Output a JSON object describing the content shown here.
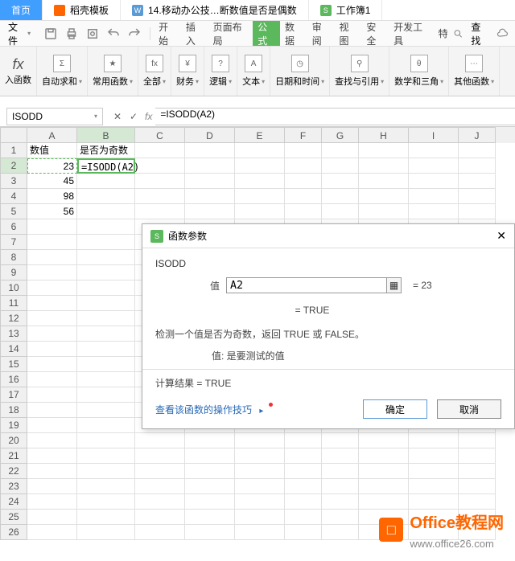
{
  "tabs": {
    "home": "首页",
    "template": "稻壳模板",
    "doc": "14.移动办公技…断数值是否是偶数",
    "workbook": "工作簿1"
  },
  "menu": {
    "file": "文件",
    "start": "开始",
    "insert": "插入",
    "layout": "页面布局",
    "formula": "公式",
    "data": "数据",
    "review": "审阅",
    "view": "视图",
    "security": "安全",
    "dev": "开发工具",
    "special": "特",
    "search": "查找"
  },
  "ribbon": {
    "insert_fn": "入函数",
    "autosum": "自动求和",
    "common": "常用函数",
    "all": "全部",
    "financial": "财务",
    "logical": "逻辑",
    "text": "文本",
    "datetime": "日期和时间",
    "lookup": "查找与引用",
    "math": "数学和三角",
    "other": "其他函数"
  },
  "formula_bar": {
    "name": "ISODD",
    "formula": "=ISODD(A2)"
  },
  "columns": [
    "A",
    "B",
    "C",
    "D",
    "E",
    "F",
    "G",
    "H",
    "I",
    "J"
  ],
  "headers": {
    "c1": "数值",
    "c2": "是否为奇数"
  },
  "rows": [
    {
      "a": "23",
      "b": "=ISODD(A2)"
    },
    {
      "a": "45",
      "b": ""
    },
    {
      "a": "98",
      "b": ""
    },
    {
      "a": "56",
      "b": ""
    }
  ],
  "dialog": {
    "title": "函数参数",
    "fn": "ISODD",
    "arg_label": "值",
    "arg_value": "A2",
    "arg_eval": "= 23",
    "result_eval": "= TRUE",
    "desc": "检测一个值是否为奇数，返回 TRUE 或 FALSE。",
    "desc_sub": "值: 是要测试的值",
    "calc_result": "计算结果 = TRUE",
    "help": "查看该函数的操作技巧",
    "ok": "确定",
    "cancel": "取消"
  },
  "watermark": {
    "name": "Office教程网",
    "url": "www.office26.com"
  }
}
